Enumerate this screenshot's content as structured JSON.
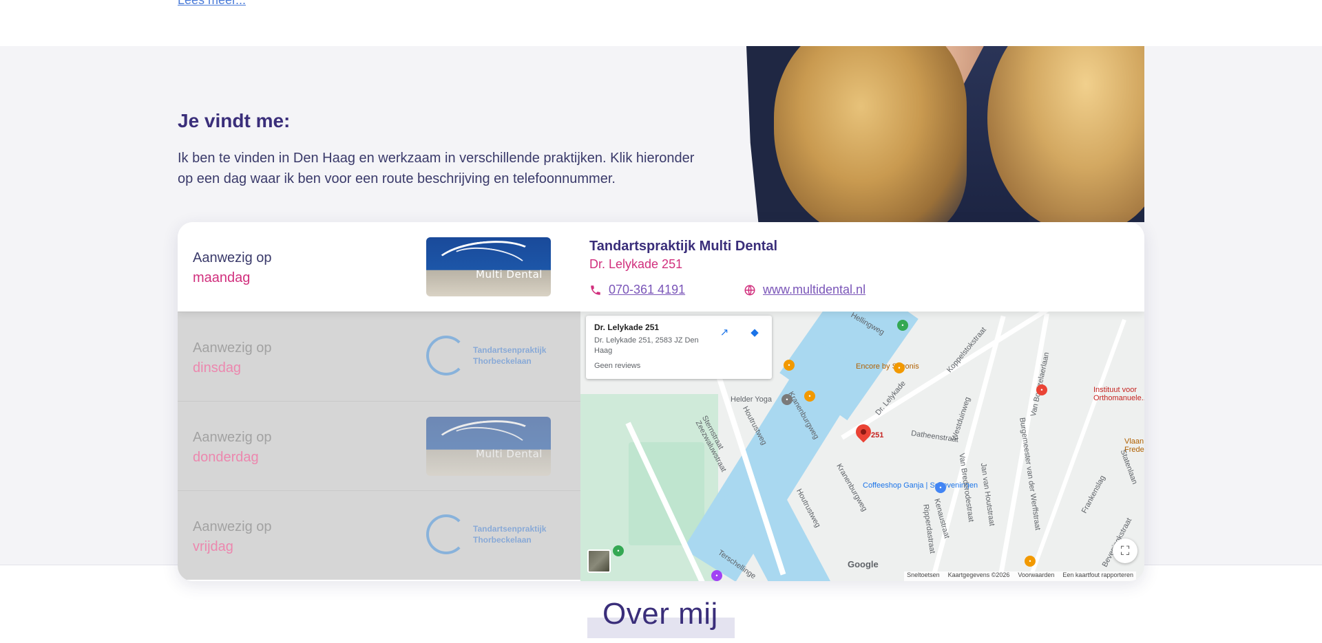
{
  "top": {
    "link_text": "Lees meer..."
  },
  "section": {
    "heading": "Je vindt me:",
    "intro": "Ik ben te vinden in Den Haag en werkzaam in verschillende praktijken. Klik hieronder op een dag waar ik ben voor een route beschrijving en telefoonnummer."
  },
  "days": [
    {
      "prefix": "Aanwezig op",
      "day": "maandag",
      "logo": "Multi Dental",
      "active": true
    },
    {
      "prefix": "Aanwezig op",
      "day": "dinsdag",
      "logo": "Tandartsenpraktijk Thorbeckelaan",
      "active": false
    },
    {
      "prefix": "Aanwezig op",
      "day": "donderdag",
      "logo": "Multi Dental",
      "active": false
    },
    {
      "prefix": "Aanwezig op",
      "day": "vrijdag",
      "logo": "Tandartsenpraktijk Thorbeckelaan",
      "active": false
    }
  ],
  "logos": {
    "multi_dental": "Multi Dental",
    "thorbecke_line1": "Tandartsenpraktijk",
    "thorbecke_line2": "Thorbeckelaan"
  },
  "practice": {
    "name": "Tandartspraktijk Multi Dental",
    "address": "Dr. Lelykade 251",
    "phone": "070-361 4191",
    "website": "www.multidental.nl"
  },
  "map": {
    "card_title": "Dr. Lelykade 251",
    "card_address": "Dr. Lelykade 251, 2583 JZ Den Haag",
    "card_reviews": "Geen reviews",
    "pin_label": "251",
    "labels": {
      "helder_yoga": "Helder Yoga",
      "encore": "Encore by Simonis",
      "coffeeshop": "Coffeeshop Ganja | Scheveningen",
      "instituut": "Instituut voor Orthomanuele...",
      "vlaan": "Vlaan Freder",
      "datheenstraat": "Datheenstraat",
      "dr_lelykade": "Dr. Lelykade",
      "westduinweg": "Westduinweg",
      "kranenburgweg": "Kranenburgweg",
      "houtrustweg": "Houtrustweg",
      "sternstraat": "Sternstraat",
      "zeezwaluwstraat": "Zeezwaluwstraat",
      "koppelstokstraat": "Koppelstokstraat",
      "van_boetzelaerlaan": "Van Boetzelaerlaan",
      "burgemeester": "Burgemeester van der Werffstraat",
      "jan_van_houtstraat": "Jan van Houtstraat",
      "van_brederodestraat": "Van Brederodestraat",
      "kenaustraat": "Kenaustraat",
      "ripperdastraat": "Ripperdastraat",
      "frankenslag": "Frankenslag",
      "statenlaan": "Statenlaan",
      "beveningkstraat": "Beveningkstraat",
      "terschellinge": "Terschellinge",
      "hellingweg": "Hellingweg"
    },
    "google": "Google",
    "footer": [
      "Sneltoetsen",
      "Kaartgegevens ©2026",
      "Voorwaarden",
      "Een kaartfout rapporteren"
    ]
  },
  "about": {
    "title": "Over mij"
  },
  "colors": {
    "accent_pink": "#d12f7d",
    "heading_purple": "#3a2e7a",
    "map_water": "#a9d8f0"
  }
}
